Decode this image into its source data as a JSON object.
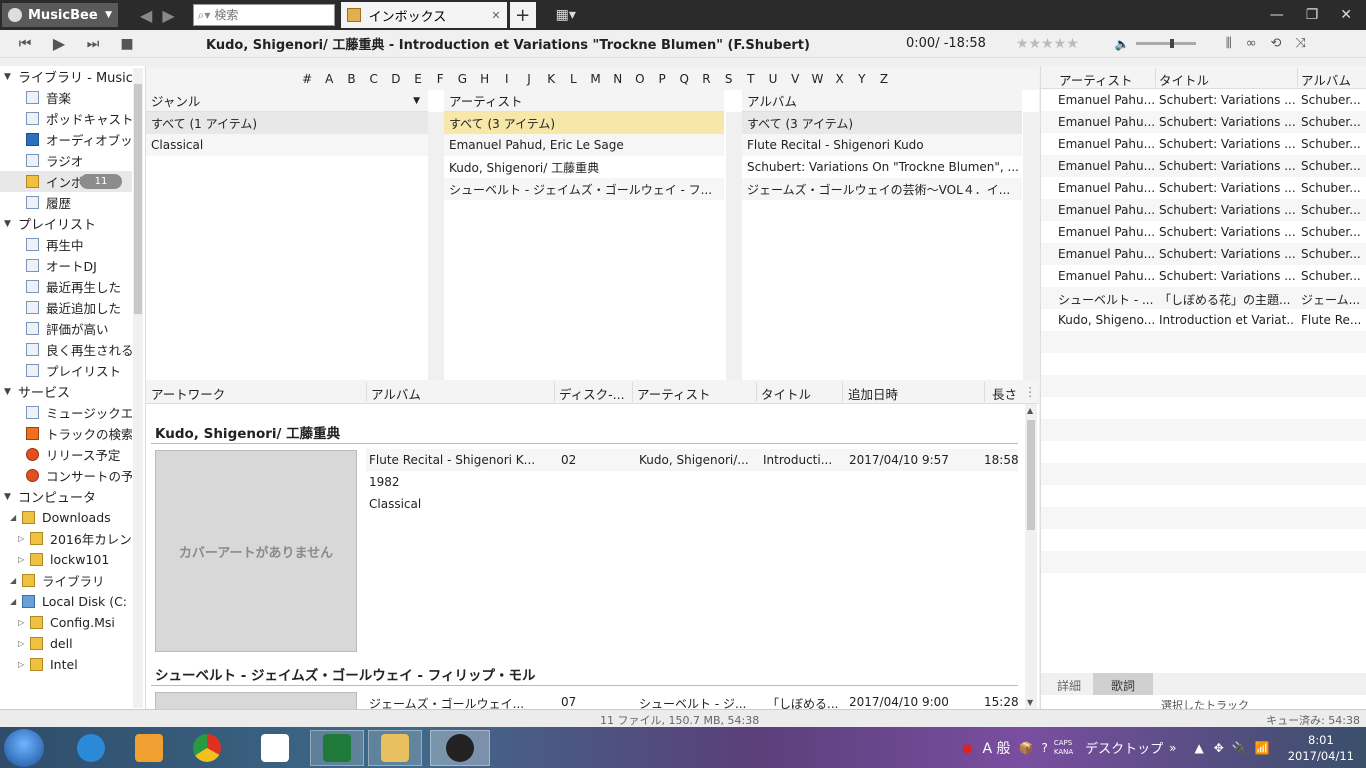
{
  "titlebar": {
    "app_name": "MusicBee",
    "search_placeholder": "検索",
    "tab_label": "インボックス"
  },
  "player": {
    "now_playing": "Kudo, Shigenori/ 工藤重典 - Introduction et Variations \"Trockne Blumen\" (F.Shubert)",
    "time": "0:00/ -18:58",
    "rating_stars": "★★★★★",
    "volume_level": 0.6
  },
  "sidebar": {
    "library_header": "ライブラリ - Musicb",
    "library_items": [
      {
        "label": "音楽",
        "icon": "music-note-icon"
      },
      {
        "label": "ポッドキャスト",
        "icon": "podcast-icon"
      },
      {
        "label": "オーディオブック",
        "icon": "audiobook-icon"
      },
      {
        "label": "ラジオ",
        "icon": "radio-icon"
      },
      {
        "label": "インボックス",
        "icon": "inbox-icon",
        "badge": "11"
      },
      {
        "label": "履歴",
        "icon": "history-icon"
      }
    ],
    "playlist_header": "プレイリスト",
    "playlist_items": [
      "再生中",
      "オートDJ",
      "最近再生した",
      "最近追加した",
      "評価が高い",
      "良く再生される",
      "プレイリスト"
    ],
    "services_header": "サービス",
    "service_items": [
      "ミュージックエ",
      "トラックの検索",
      "リリース予定",
      "コンサートの予"
    ],
    "computer_header": "コンピュータ",
    "computer_items": [
      {
        "label": "Downloads",
        "level": 1
      },
      {
        "label": "2016年カレン",
        "level": 2
      },
      {
        "label": "lockw101",
        "level": 2
      },
      {
        "label": "ライブラリ",
        "level": 1
      },
      {
        "label": "Local Disk (C:",
        "level": 1
      },
      {
        "label": "Config.Msi",
        "level": 2
      },
      {
        "label": "dell",
        "level": 2
      },
      {
        "label": "Intel",
        "level": 2
      }
    ]
  },
  "alphabet": [
    "#",
    "A",
    "B",
    "C",
    "D",
    "E",
    "F",
    "G",
    "H",
    "I",
    "J",
    "K",
    "L",
    "M",
    "N",
    "O",
    "P",
    "Q",
    "R",
    "S",
    "T",
    "U",
    "V",
    "W",
    "X",
    "Y",
    "Z"
  ],
  "browser": {
    "genre": {
      "header": "ジャンル",
      "rows": [
        "すべて (1 アイテム)",
        "Classical"
      ]
    },
    "artist": {
      "header": "アーティスト",
      "rows": [
        "すべて (3 アイテム)",
        "Emanuel Pahud, Eric Le Sage",
        "Kudo, Shigenori/ 工藤重典",
        "シューベルト - ジェイムズ・ゴールウェイ - フ..."
      ]
    },
    "album": {
      "header": "アルバム",
      "rows": [
        "すべて (3 アイテム)",
        "Flute Recital - Shigenori Kudo",
        "Schubert: Variations On \"Trockne Blumen\", ...",
        "ジェームズ・ゴールウェイの芸術～VOL４．イ..."
      ]
    }
  },
  "tracklist": {
    "columns": [
      "アートワーク",
      "アルバム",
      "ディスク-...",
      "アーティスト",
      "タイトル",
      "追加日時",
      "長さ"
    ],
    "groups": [
      {
        "title": "Kudo, Shigenori/ 工藤重典",
        "cover_text": "カバーアートがありません",
        "album": "Flute Recital - Shigenori K...",
        "year": "1982",
        "genre": "Classical",
        "disc": "02",
        "artist": "Kudo, Shigenori/...",
        "track_title": "Introducti...",
        "added": "2017/04/10 9:57",
        "length": "18:58"
      },
      {
        "title": "シューベルト - ジェイムズ・ゴールウェイ - フィリップ・モル",
        "album": "ジェームズ・ゴールウェイ...",
        "disc": "07",
        "artist": "シューベルト - ジ...",
        "track_title": "「しぼめる...",
        "added": "2017/04/10 9:00",
        "length": "15:28"
      }
    ]
  },
  "queue": {
    "columns": [
      "アーティスト",
      "タイトル",
      "アルバム"
    ],
    "rows": [
      [
        "Emanuel Pahu...",
        "Schubert: Variations ...",
        "Schuber..."
      ],
      [
        "Emanuel Pahu...",
        "Schubert: Variations ...",
        "Schuber..."
      ],
      [
        "Emanuel Pahu...",
        "Schubert: Variations ...",
        "Schuber..."
      ],
      [
        "Emanuel Pahu...",
        "Schubert: Variations ...",
        "Schuber..."
      ],
      [
        "Emanuel Pahu...",
        "Schubert: Variations ...",
        "Schuber..."
      ],
      [
        "Emanuel Pahu...",
        "Schubert: Variations ...",
        "Schuber..."
      ],
      [
        "Emanuel Pahu...",
        "Schubert: Variations ...",
        "Schuber..."
      ],
      [
        "Emanuel Pahu...",
        "Schubert: Variations ...",
        "Schuber..."
      ],
      [
        "Emanuel Pahu...",
        "Schubert: Variations ...",
        "Schuber..."
      ],
      [
        "シューベルト - ...",
        "「しぼめる花」の主題...",
        "ジェーム..."
      ],
      [
        "Kudo, Shigeno...",
        "Introduction et Variat...",
        "Flute Re..."
      ]
    ],
    "tab_details": "詳細",
    "tab_lyrics": "歌詞",
    "sub_text": "選択したトラック"
  },
  "status": {
    "summary": "11 ファイル, 150.7 MB, 54:38",
    "queued": "キュー済み: 54:38"
  },
  "taskbar": {
    "ime": "A 般",
    "caps": "CAPS",
    "kana": "KANA",
    "desktop": "デスクトップ",
    "time": "8:01",
    "date": "2017/04/11"
  }
}
